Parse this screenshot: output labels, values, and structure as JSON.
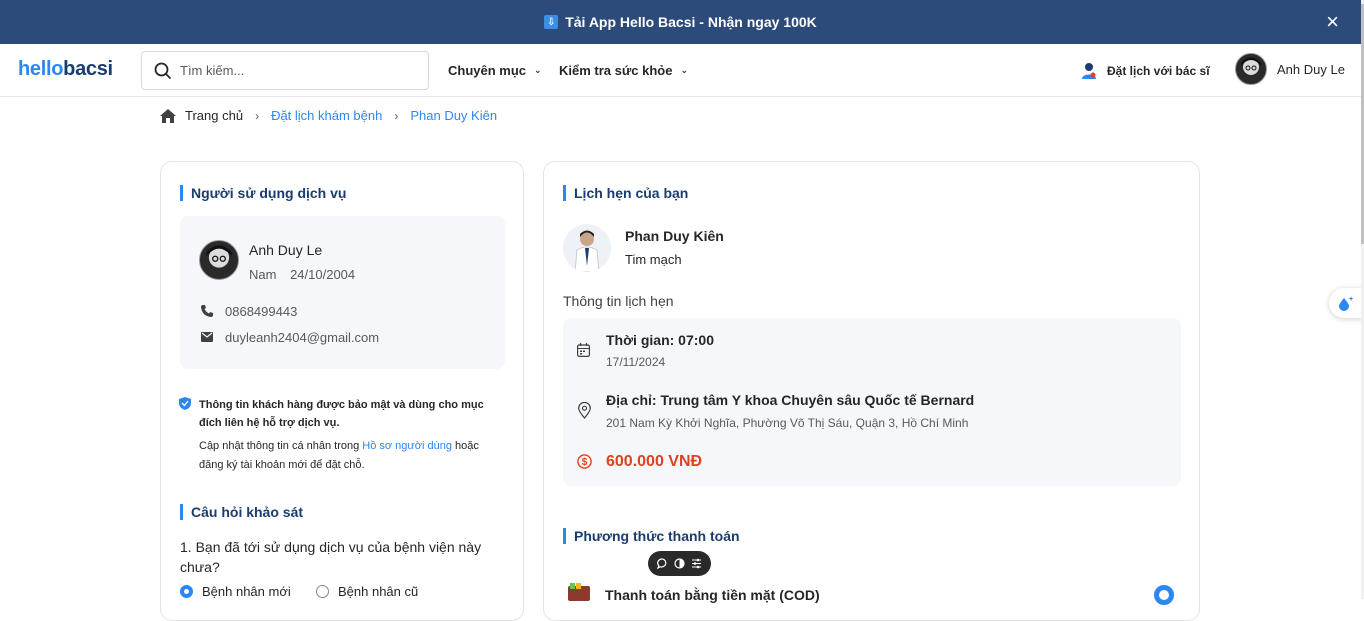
{
  "promo": {
    "text": "Tải App Hello Bacsi - Nhận ngay 100K",
    "close": "×"
  },
  "nav": {
    "logo_a": "hello",
    "logo_b": "bacsi",
    "search_placeholder": "Tìm kiếm...",
    "menu_1": "Chuyên mục",
    "menu_2": "Kiểm tra sức khỏe",
    "book": "Đặt lịch với bác sĩ",
    "user": "Anh Duy Le"
  },
  "breadcrumb": {
    "home": "Trang chủ",
    "booking": "Đặt lịch khám bệnh",
    "doctor": "Phan Duy Kiên"
  },
  "left": {
    "title": "Người sử dụng dịch vụ",
    "name": "Anh Duy Le",
    "gender": "Nam",
    "dob": "24/10/2004",
    "phone": "0868499443",
    "email": "duyleanh2404@gmail.com",
    "privacy_bold": "Thông tin khách hàng được bảo mật và dùng cho mục đích liên hệ hỗ trợ dịch vụ.",
    "privacy_pre": "Cập nhật thông tin cá nhân trong ",
    "privacy_link": "Hồ sơ người dùng",
    "privacy_post": " hoặc đăng ký tài khoản mới để đặt chỗ.",
    "survey_title": "Câu hỏi khảo sát",
    "question": "1. Bạn đã tới sử dụng dịch vụ của bệnh viện này chưa?",
    "opt_new": "Bệnh nhân mới",
    "opt_old": "Bệnh nhân cũ"
  },
  "right": {
    "title": "Lịch hẹn của bạn",
    "doctor_name": "Phan Duy Kiên",
    "specialty": "Tim mạch",
    "info_title": "Thông tin lịch hẹn",
    "time": "Thời gian: 07:00",
    "date": "17/11/2024",
    "address_title": "Địa chỉ: Trung tâm Y khoa Chuyên sâu Quốc tế Bernard",
    "address": "201 Nam Kỳ Khởi Nghĩa, Phường Võ Thị Sáu, Quận 3, Hồ Chí Minh",
    "price": "600.000 VNĐ",
    "payment_title": "Phương thức thanh toán",
    "payment_cod": "Thanh toán bằng tiền mặt (COD)"
  },
  "colors": {
    "accent": "#2d87f3",
    "navy": "#1b3c6e",
    "price": "#e0411e",
    "promo_bg": "#2c4a7a"
  }
}
